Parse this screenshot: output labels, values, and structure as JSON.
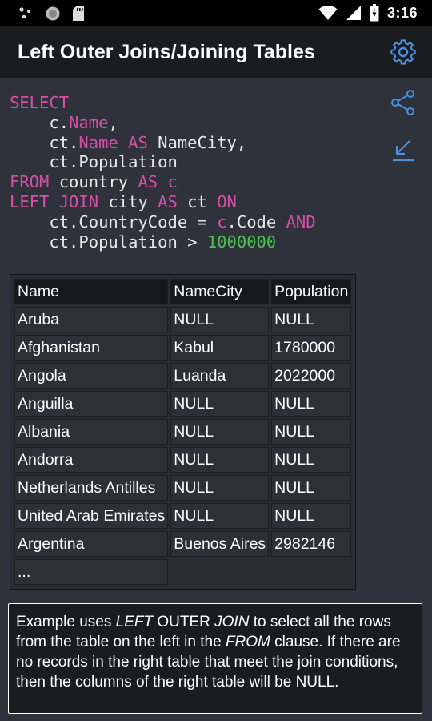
{
  "status_bar": {
    "time": "3:16",
    "icons": [
      "dots-icon",
      "record-icon",
      "sd-card-icon",
      "wifi-icon",
      "signal-icon",
      "battery-icon"
    ]
  },
  "app_bar": {
    "title": "Left Outer Joins/Joining Tables",
    "settings_icon": "gear-icon"
  },
  "side_actions": [
    {
      "name": "share-icon"
    },
    {
      "name": "collapse-icon"
    }
  ],
  "code": {
    "line1": "SELECT",
    "line2_a": "    c.",
    "line2_b": "Name",
    "line2_c": ",",
    "line3_a": "    ct.",
    "line3_b": "Name",
    "line3_c": " ",
    "line3_d": "AS",
    "line3_e": " NameCity,",
    "line4": "    ct.Population",
    "line5_a": "FROM",
    "line5_b": " country ",
    "line5_c": "AS",
    "line5_d": " ",
    "line5_e": "c",
    "line6_a": "LEFT JOIN",
    "line6_b": " city ",
    "line6_c": "AS",
    "line6_d": " ct ",
    "line6_e": "ON",
    "line7_a": "    ct.CountryCode = ",
    "line7_b": "c",
    "line7_c": ".Code ",
    "line7_d": "AND",
    "line8_a": "    ct.Population > ",
    "line8_b": "1000000"
  },
  "table": {
    "headers": [
      "Name",
      "NameCity",
      "Population"
    ],
    "rows": [
      [
        "Aruba",
        "NULL",
        "NULL"
      ],
      [
        "Afghanistan",
        "Kabul",
        "1780000"
      ],
      [
        "Angola",
        "Luanda",
        "2022000"
      ],
      [
        "Anguilla",
        "NULL",
        "NULL"
      ],
      [
        "Albania",
        "NULL",
        "NULL"
      ],
      [
        "Andorra",
        "NULL",
        "NULL"
      ],
      [
        "Netherlands Antilles",
        "NULL",
        "NULL"
      ],
      [
        "United Arab Emirates",
        "NULL",
        "NULL"
      ],
      [
        "Argentina",
        "Buenos Aires",
        "2982146"
      ]
    ],
    "ellipsis": "..."
  },
  "note": {
    "p1": "Example uses ",
    "p2": "LEFT",
    "p3": " OUTER ",
    "p4": "JOIN",
    "p5": " to select all the rows from the table on the left in the ",
    "p6": "FROM",
    "p7": " clause. If there are no records in the right table that meet the join conditions, then the columns of the right table will be NULL."
  },
  "colors": {
    "keyword": "#d64fa7",
    "number": "#4ec24e",
    "accent_icon": "#4a90e2"
  }
}
